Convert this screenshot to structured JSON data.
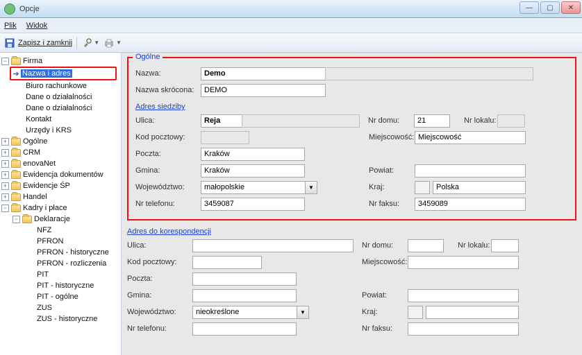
{
  "window": {
    "title": "Opcje"
  },
  "menubar": {
    "file": "Plik",
    "view": "Widok"
  },
  "toolbar": {
    "save_close": "Zapisz i zamknij"
  },
  "tree": {
    "firma": "Firma",
    "nazwa_adres": "Nazwa i adres",
    "biuro": "Biuro rachunkowe",
    "dane1": "Dane o działalności",
    "dane2": "Dane o działalności",
    "kontakt": "Kontakt",
    "urzedy": "Urzędy i KRS",
    "ogolne": "Ogólne",
    "crm": "CRM",
    "enovanet": "enovaNet",
    "ewid_dok": "Ewidencja dokumentów",
    "ewid_sp": "Ewidencje ŚP",
    "handel": "Handel",
    "kadry": "Kadry i płace",
    "deklaracje": "Deklaracje",
    "nfz": "NFZ",
    "pfron": "PFRON",
    "pfron_hist": "PFRON - historyczne",
    "pfron_rozl": "PFRON - rozliczenia",
    "pit": "PIT",
    "pit_hist": "PIT - historyczne",
    "pit_ogolne": "PIT - ogólne",
    "zus": "ZUS",
    "zus_hist": "ZUS - historyczne"
  },
  "general": {
    "legend": "Ogólne",
    "nazwa_lbl": "Nazwa:",
    "nazwa_val": "Demo",
    "skrocona_lbl": "Nazwa skrócona:",
    "skrocona_val": "DEMO"
  },
  "address": {
    "legend": "Adres siedziby",
    "ulica_lbl": "Ulica:",
    "ulica_val": "Reja",
    "nrdomu_lbl": "Nr domu:",
    "nrdomu_val": "21",
    "nrlokalu_lbl": "Nr lokalu:",
    "nrlokalu_val": "",
    "kod_lbl": "Kod pocztowy:",
    "kod_val": "",
    "miejsc_lbl": "Miejscowość:",
    "miejsc_val": "Miejscowość",
    "poczta_lbl": "Poczta:",
    "poczta_val": "Kraków",
    "gmina_lbl": "Gmina:",
    "gmina_val": "Kraków",
    "powiat_lbl": "Powiat:",
    "powiat_val": "",
    "woj_lbl": "Województwo:",
    "woj_val": "małopolskie",
    "kraj_lbl": "Kraj:",
    "kraj_val": "Polska",
    "tel_lbl": "Nr telefonu:",
    "tel_val": "3459087",
    "fax_lbl": "Nr faksu:",
    "fax_val": "3459089"
  },
  "corr": {
    "legend": "Adres do korespondencji",
    "ulica_lbl": "Ulica:",
    "ulica_val": "",
    "nrdomu_lbl": "Nr domu:",
    "nrdomu_val": "",
    "nrlokalu_lbl": "Nr lokalu:",
    "nrlokalu_val": "",
    "kod_lbl": "Kod pocztowy:",
    "kod_val": "",
    "miejsc_lbl": "Miejscowość:",
    "miejsc_val": "",
    "poczta_lbl": "Poczta:",
    "poczta_val": "",
    "gmina_lbl": "Gmina:",
    "gmina_val": "",
    "powiat_lbl": "Powiat:",
    "powiat_val": "",
    "woj_lbl": "Województwo:",
    "woj_val": "nieokreślone",
    "kraj_lbl": "Kraj:",
    "kraj_val": "",
    "tel_lbl": "Nr telefonu:",
    "tel_val": "",
    "fax_lbl": "Nr faksu:",
    "fax_val": ""
  }
}
